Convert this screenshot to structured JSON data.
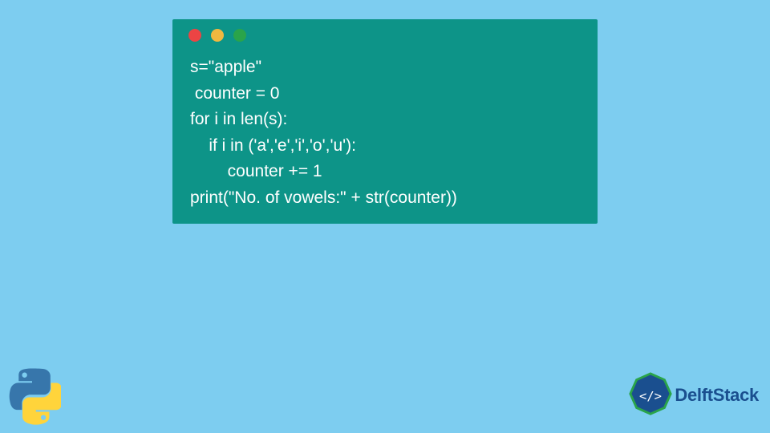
{
  "code": {
    "lines": [
      "s=\"apple\"",
      " counter = 0",
      "for i in len(s):",
      "    if i in ('a','e','i','o','u'):",
      "        counter += 1",
      "print(\"No. of vowels:\" + str(counter))"
    ]
  },
  "branding": {
    "name": "DelftStack"
  },
  "colors": {
    "background": "#7dcdf0",
    "codeWindow": "#0d9488",
    "codeText": "#ffffff",
    "brandBlue": "#1a4f8f",
    "dotRed": "#ec4444",
    "dotYellow": "#f0b840",
    "dotGreen": "#2aa44a"
  }
}
